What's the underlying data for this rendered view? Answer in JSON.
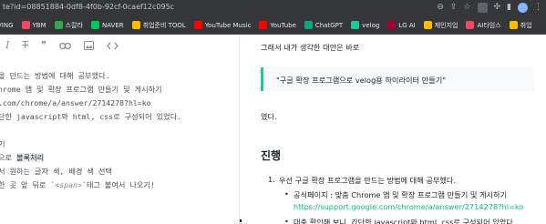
{
  "browser": {
    "url": "te?id=08851884-0df8-4f0b-92cf-0caef12c095c",
    "bookmarks": [
      {
        "label": "VING",
        "color": "#e8eaed"
      },
      {
        "label": "YBM",
        "color": "#e84a5f"
      },
      {
        "label": "스칼라",
        "color": "#34a853"
      },
      {
        "label": "NAVER",
        "color": "#03c75a"
      },
      {
        "label": "취업준비 TOOL",
        "color": "#fbbc04"
      },
      {
        "label": "YouTube Music",
        "color": "#ff0000"
      },
      {
        "label": "YouTube",
        "color": "#ff0000"
      },
      {
        "label": "ChatGPT",
        "color": "#10a37f"
      },
      {
        "label": "velog",
        "color": "#20c997"
      },
      {
        "label": "LG AI",
        "color": "#a50034"
      },
      {
        "label": "제인지업",
        "color": "#fbbc04"
      },
      {
        "label": "AI타임스",
        "color": "#e84a5f"
      },
      {
        "label": "취업",
        "color": "#fbbc04"
      }
    ]
  },
  "editor": {
    "toolbar": {
      "italic": "I",
      "strike": "T",
      "quote": "❞"
    },
    "lines": [
      "을 만드는 방법에 대해 공부했다.",
      "hrome 앱 및 확장 프로그램 만들기 및 게시하기",
      ".com/chrome/a/answer/2714278?hl=ko",
      "단한 javascript와 html, css로 구성되어 있었다.",
      "",
      "기",
      "으로 ",
      "서 원하는 글자 색, 배경 색 선택",
      "한 곳 앞 뒤로 `",
      ""
    ],
    "highlight_word": "볼록처리",
    "span_tag": "<span>",
    "line9_tail": "`태그 붙여서 나오기!"
  },
  "preview": {
    "intro": "그래서 내가 생각한 대안은 바로",
    "quote": "\"구글 확장 프로그램으로 velog용 하이라이터 만들기\"",
    "after_quote": "였다.",
    "heading": "진행",
    "item1_num": "1.",
    "item1": "우선 구글 확장 프로그램을 만드는 방법에 대해 공부했다.",
    "bullet": "•",
    "sub1": "공식페이지 : 맞춤 Chrome 앱 및 확장 프로그램 만들기 및 게시하기",
    "sub1_link": "https://support.google.com/chrome/a/answer/2714278?hl=ko",
    "sub2": "대충 확인해 보니, 간단한 javascript와 html, css로 구성되어 있었다."
  }
}
